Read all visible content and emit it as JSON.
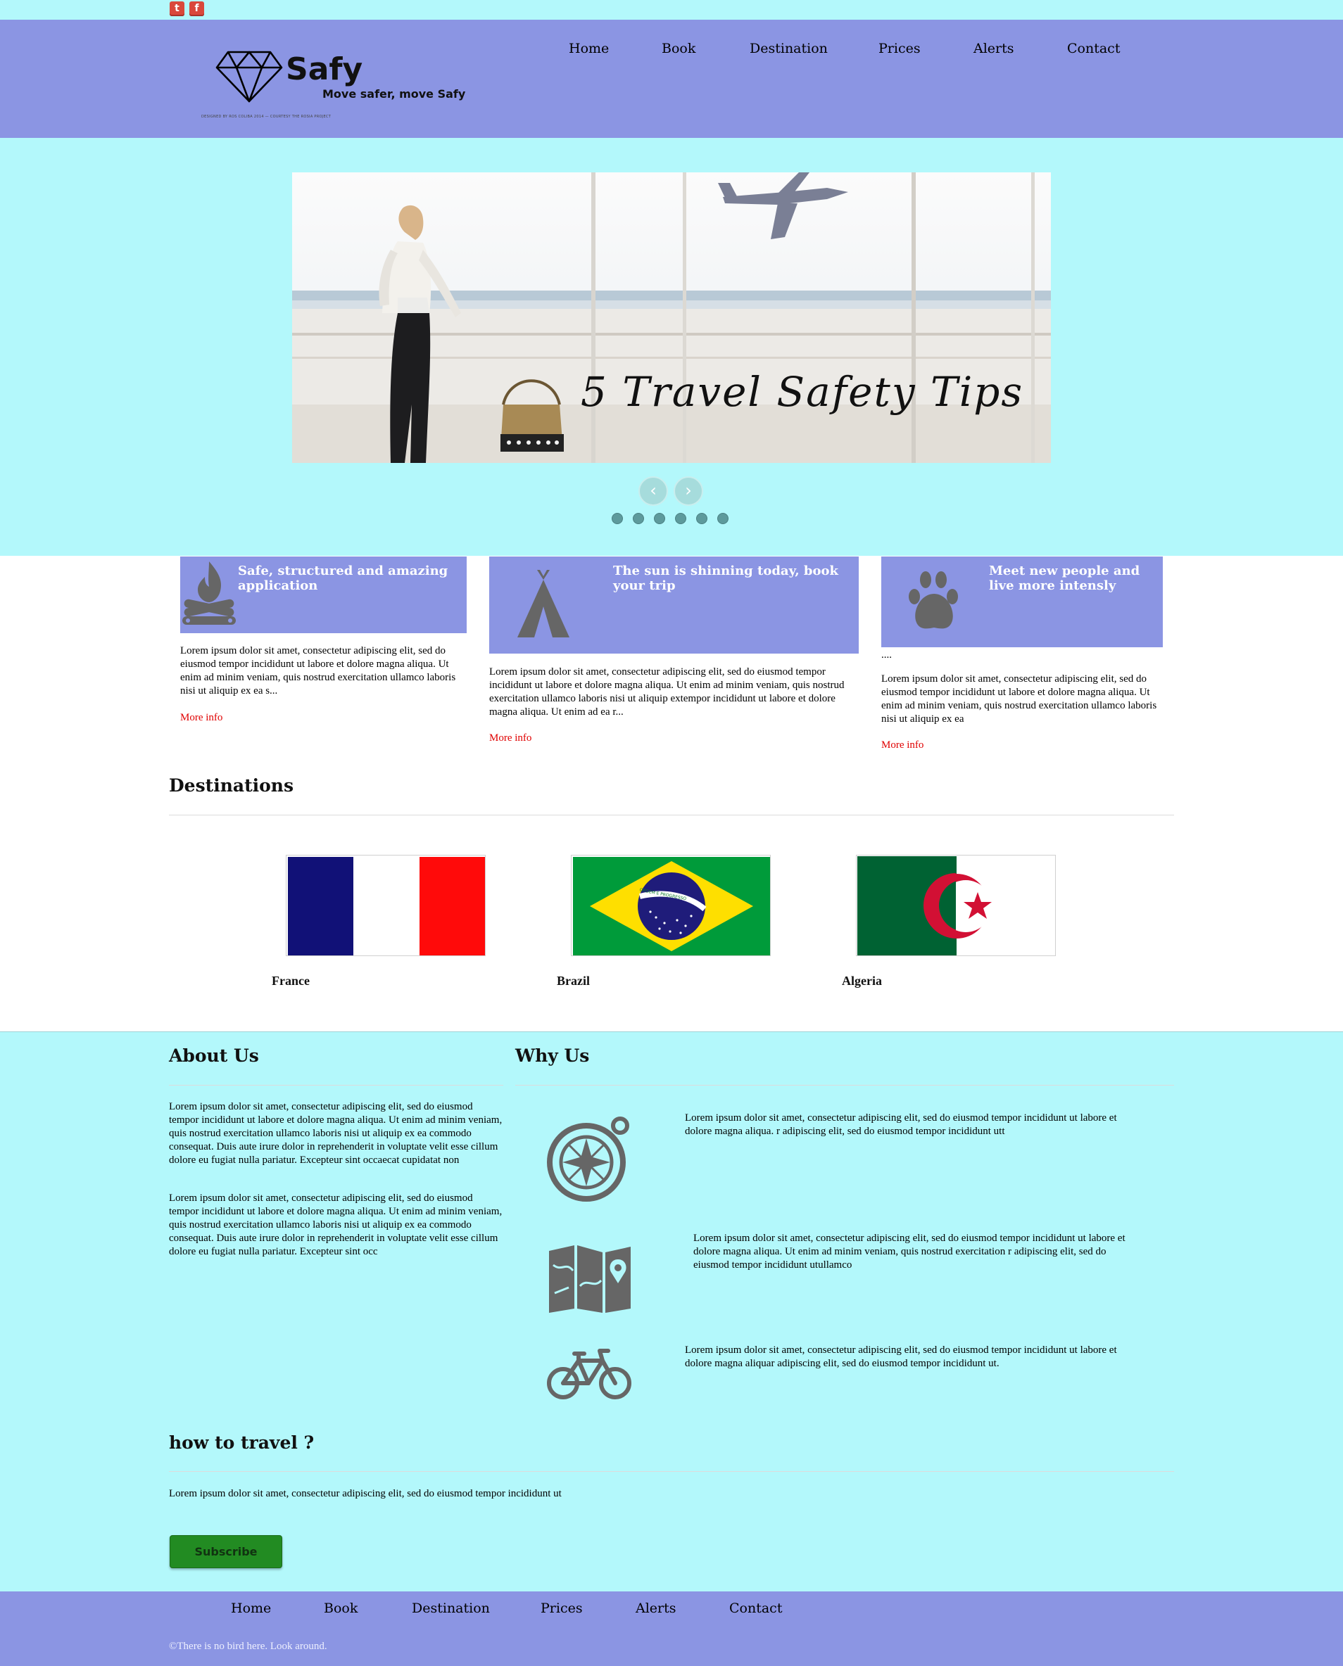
{
  "social": {
    "twitter_glyph": "t",
    "facebook_glyph": "f"
  },
  "brand": {
    "name": "Safy",
    "tagline": "Move safer, move Safy",
    "fineprint": "DESIGNED BY ROS COLIBA 2014 — COURTESY THE ROSIA PROJECT"
  },
  "nav": {
    "home": "Home",
    "book": "Book",
    "destination": "Destination",
    "prices": "Prices",
    "alerts": "Alerts",
    "contact": "Contact"
  },
  "slider": {
    "caption": "5 Travel Safety Tips",
    "prev": "‹",
    "next": "›",
    "dot_count": 6
  },
  "features": [
    {
      "title": "Safe, structured and amazing application",
      "text": "Lorem ipsum dolor sit amet, consectetur adipiscing elit, sed do eiusmod tempor incididunt ut labore et dolore magna aliqua. Ut enim ad minim veniam, quis nostrud exercitation ullamco laboris nisi ut aliquip ex ea s...",
      "more": "More info"
    },
    {
      "title": "The sun is shinning today, book your trip",
      "text": "Lorem ipsum dolor sit amet, consectetur adipiscing elit, sed do eiusmod tempor incididunt ut labore et dolore magna aliqua. Ut enim ad minim veniam, quis nostrud exercitation ullamco laboris nisi ut aliquip extempor incididunt ut labore et dolore magna aliqua. Ut enim ad ea r...",
      "more": "More info"
    },
    {
      "title": "Meet new people and live more intensly",
      "dots": "....",
      "text": "Lorem ipsum dolor sit amet, consectetur adipiscing elit, sed do eiusmod tempor incididunt ut labore et dolore magna aliqua. Ut enim ad minim veniam, quis nostrud exercitation ullamco laboris nisi ut aliquip ex ea",
      "more": "More info"
    }
  ],
  "destinations": {
    "title": "Destinations",
    "items": [
      "France",
      "Brazil",
      "Algeria"
    ],
    "brazil_motto": "ORDEM E PROGRESSO"
  },
  "about": {
    "title": "About Us",
    "p1": "Lorem ipsum dolor sit amet, consectetur adipiscing elit, sed do eiusmod tempor incididunt ut labore et dolore magna aliqua. Ut enim ad minim veniam, quis nostrud exercitation ullamco laboris nisi ut aliquip ex ea commodo consequat. Duis aute irure dolor in reprehenderit in voluptate velit esse cillum dolore eu fugiat nulla pariatur. Excepteur sint occaecat cupidatat non",
    "p2": "Lorem ipsum dolor sit amet, consectetur adipiscing elit, sed do eiusmod tempor incididunt ut labore et dolore magna aliqua. Ut enim ad minim veniam, quis nostrud exercitation ullamco laboris nisi ut aliquip ex ea commodo consequat. Duis aute irure dolor in reprehenderit in voluptate velit esse cillum dolore eu fugiat nulla pariatur. Excepteur sint occ"
  },
  "why": {
    "title": "Why Us",
    "items": [
      {
        "icon": "compass-icon",
        "text": "Lorem ipsum dolor sit amet, consectetur adipiscing elit, sed do eiusmod tempor incididunt ut labore et dolore magna aliqua. r adipiscing elit, sed do eiusmod tempor incididunt utt"
      },
      {
        "icon": "map-icon",
        "text": "Lorem ipsum dolor sit amet, consectetur adipiscing elit, sed do eiusmod tempor incididunt ut labore et dolore magna aliqua. Ut enim ad minim veniam, quis nostrud exercitation r adipiscing elit, sed do eiusmod tempor incididunt utullamco"
      },
      {
        "icon": "bicycle-icon",
        "text": "Lorem ipsum dolor sit amet, consectetur adipiscing elit, sed do eiusmod tempor incididunt ut labore et dolore magna aliquar adipiscing elit, sed do eiusmod tempor incididunt ut."
      }
    ]
  },
  "howto": {
    "title": "how to travel ?",
    "text": "Lorem ipsum dolor sit amet, consectetur adipiscing elit, sed do eiusmod tempor incididunt ut",
    "button": "Subscribe"
  },
  "footer": {
    "copyright": "©There is no bird here. Look around."
  },
  "colors": {
    "aqua": "#b3f8fb",
    "periwinkle": "#8b95e3",
    "link_red": "#e00000",
    "button_green": "#228b22",
    "icon_gray": "#666666"
  }
}
